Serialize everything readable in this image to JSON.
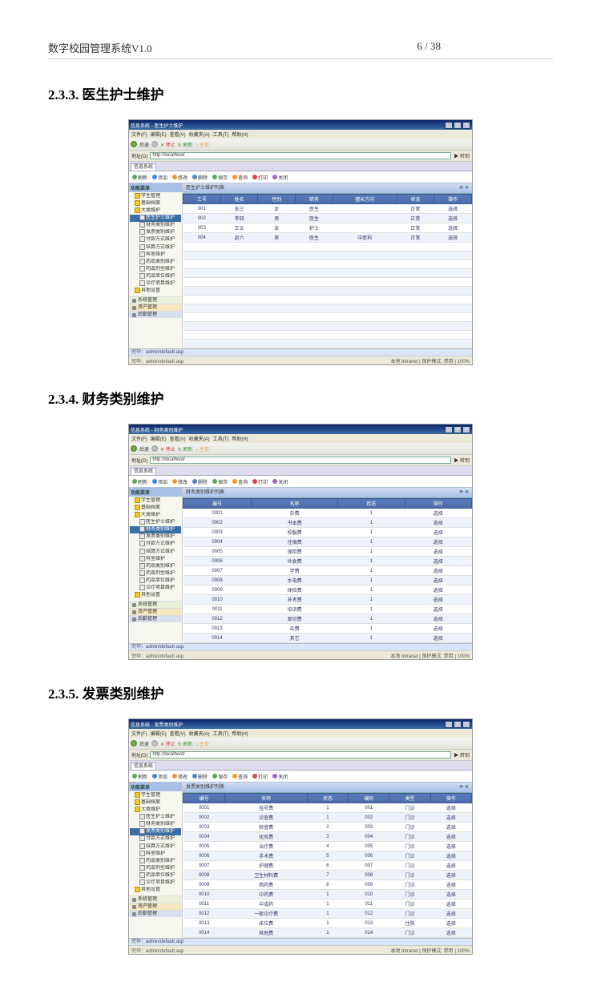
{
  "doc": {
    "header_title": "数字校园管理系统V1.0",
    "page_indicator": "6 / 38"
  },
  "sections": [
    {
      "num": "2.3.3.",
      "title": "医生护士维护"
    },
    {
      "num": "2.3.4.",
      "title": "财务类别维护"
    },
    {
      "num": "2.3.5.",
      "title": "发票类别维护"
    }
  ],
  "browser": {
    "title_prefix": "信息系统 - ",
    "menu": [
      "文件(F)",
      "编辑(E)",
      "查看(V)",
      "收藏夹(A)",
      "工具(T)",
      "帮助(H)"
    ],
    "toolbar1": [
      "后退",
      "前进",
      "停止",
      "刷新",
      "主页"
    ],
    "address_label": "地址(D)",
    "url": "http://localhost/",
    "go": "转到",
    "tab": "信息系统",
    "toolbar2": [
      "刷新",
      "添加",
      "修改",
      "删除",
      "保存",
      "查询",
      "打印",
      "关闭"
    ],
    "status_left": "完毕：admin/default.asp",
    "status_right_items": [
      "本地 Intranet",
      "保护模式: 禁用",
      "100%"
    ]
  },
  "sidebar": {
    "title": "功能菜单",
    "tree": [
      "学生管理",
      "基础档案",
      "大类维护",
      "  医生护士维护",
      "  财务类别维护",
      "  发票类别维护",
      "  付款方式维护",
      "  结算方式维护",
      "  科室维护",
      "  药品类别维护",
      "  药品剂型维护",
      "  药品单位维护",
      "  诊疗项目维护",
      "其他设置"
    ],
    "bottom_nav": [
      "系统管理",
      "资产管理",
      "后勤管理"
    ]
  },
  "table1": {
    "panel_title": "医生护士维护列表",
    "cols": [
      "工号",
      "姓名",
      "性别",
      "职务",
      "擅长方向",
      "状态",
      "操作"
    ],
    "rows": [
      [
        "001",
        "张三",
        "女",
        "医生",
        "",
        "正常",
        "选择"
      ],
      [
        "002",
        "李四",
        "男",
        "医生",
        "",
        "正常",
        "选择"
      ],
      [
        "003",
        "王五",
        "女",
        "护士",
        "",
        "正常",
        "选择"
      ],
      [
        "004",
        "赵六",
        "男",
        "医生",
        "中医科",
        "正常",
        "选择"
      ]
    ],
    "empty_rows": 12
  },
  "table2": {
    "panel_title": "财务类别维护列表",
    "cols": [
      "编号",
      "名称",
      "状态",
      "操作"
    ],
    "rows": [
      [
        "0001",
        "杂费",
        "1",
        "选择"
      ],
      [
        "0002",
        "书本费",
        "1",
        "选择"
      ],
      [
        "0003",
        "校服费",
        "1",
        "选择"
      ],
      [
        "0004",
        "住宿费",
        "1",
        "选择"
      ],
      [
        "0005",
        "保险费",
        "1",
        "选择"
      ],
      [
        "0006",
        "伙食费",
        "1",
        "选择"
      ],
      [
        "0007",
        "学费",
        "1",
        "选择"
      ],
      [
        "0008",
        "水电费",
        "1",
        "选择"
      ],
      [
        "0009",
        "体检费",
        "1",
        "选择"
      ],
      [
        "0010",
        "补考费",
        "1",
        "选择"
      ],
      [
        "0011",
        "培训费",
        "1",
        "选择"
      ],
      [
        "0012",
        "复印费",
        "1",
        "选择"
      ],
      [
        "0013",
        "杂费",
        "1",
        "选择"
      ],
      [
        "0014",
        "其它",
        "1",
        "选择"
      ]
    ]
  },
  "table3": {
    "panel_title": "发票类别维护列表",
    "cols": [
      "编号",
      "名称",
      "状态",
      "编码",
      "类型",
      "操作"
    ],
    "rows": [
      [
        "0001",
        "挂号费",
        "1",
        "001",
        "门诊",
        "选择"
      ],
      [
        "0002",
        "诊查费",
        "1",
        "002",
        "门诊",
        "选择"
      ],
      [
        "0003",
        "检查费",
        "2",
        "003",
        "门诊",
        "选择"
      ],
      [
        "0004",
        "化验费",
        "3",
        "004",
        "门诊",
        "选择"
      ],
      [
        "0005",
        "治疗费",
        "4",
        "005",
        "门诊",
        "选择"
      ],
      [
        "0006",
        "手术费",
        "5",
        "006",
        "门诊",
        "选择"
      ],
      [
        "0007",
        "护理费",
        "6",
        "007",
        "门诊",
        "选择"
      ],
      [
        "0008",
        "卫生材料费",
        "7",
        "008",
        "门诊",
        "选择"
      ],
      [
        "0009",
        "西药费",
        "8",
        "009",
        "门诊",
        "选择"
      ],
      [
        "0010",
        "中药费",
        "1",
        "010",
        "门诊",
        "选择"
      ],
      [
        "0011",
        "中成药",
        "1",
        "011",
        "门诊",
        "选择"
      ],
      [
        "0012",
        "一般诊疗费",
        "1",
        "012",
        "门诊",
        "选择"
      ],
      [
        "0013",
        "床位费",
        "1",
        "013",
        "住院",
        "选择"
      ],
      [
        "0014",
        "其他费",
        "1",
        "014",
        "门诊",
        "选择"
      ]
    ]
  }
}
